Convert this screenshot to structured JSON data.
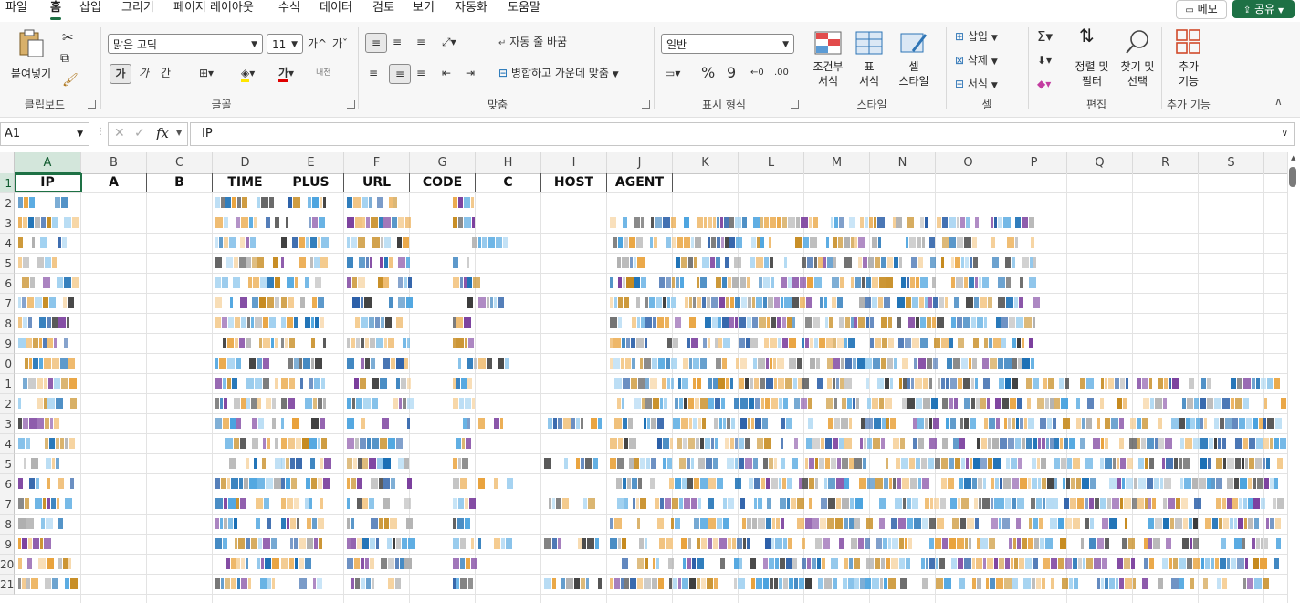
{
  "menu": [
    "파일",
    "홈",
    "삽입",
    "그리기",
    "페이지 레이아웃",
    "수식",
    "데이터",
    "검토",
    "보기",
    "자동화",
    "도움말"
  ],
  "active_menu": "홈",
  "memo_label": "메모",
  "share_label": "공유",
  "ribbon": {
    "clipboard": {
      "paste": "붙여넣기",
      "label": "클립보드"
    },
    "font": {
      "name": "맑은 고딕",
      "size": "11",
      "grow": "가^",
      "shrink": "가ˇ",
      "bold": "가",
      "italic": "가",
      "underline": "간",
      "font_color_glyph": "가",
      "phonetic": "내천",
      "label": "글꼴"
    },
    "align": {
      "wrap": "자동 줄 바꿈",
      "merge": "병합하고 가운데 맞춤",
      "label": "맞춤"
    },
    "number": {
      "format": "일반",
      "percent": "%",
      "comma": "9",
      "label": "표시 형식"
    },
    "styles": {
      "cond_line1": "조건부",
      "cond_line2": "서식",
      "table_line1": "표",
      "table_line2": "서식",
      "cell_line1": "셀",
      "cell_line2": "스타일",
      "label": "스타일"
    },
    "cells": {
      "insert": "삽입",
      "delete": "삭제",
      "format": "서식",
      "label": "셀"
    },
    "edit": {
      "sort_line1": "정렬 및",
      "sort_line2": "필터",
      "find_line1": "찾기 및",
      "find_line2": "선택",
      "label": "편집"
    },
    "addins": {
      "line1": "추가",
      "line2": "기능",
      "label": "추가 기능"
    }
  },
  "formula_bar": {
    "name_box": "A1",
    "fx": "fx",
    "content": "IP"
  },
  "columns": [
    "A",
    "B",
    "C",
    "D",
    "E",
    "F",
    "G",
    "H",
    "I",
    "J",
    "K",
    "L",
    "M",
    "N",
    "O",
    "P",
    "Q",
    "R",
    "S"
  ],
  "rows": [
    "1",
    "2",
    "3",
    "4",
    "5",
    "6",
    "7",
    "8",
    "9",
    "0",
    "1",
    "2",
    "3",
    "4",
    "5",
    "6",
    "7",
    "8",
    "9",
    "20",
    "21"
  ],
  "header_cells": [
    "IP",
    "A",
    "B",
    "TIME",
    "PLUS",
    "URL",
    "CODE",
    "C",
    "HOST",
    "AGENT"
  ],
  "colors": {
    "accent": "#1e7145",
    "selected_header_bg": "#d3e6db"
  }
}
